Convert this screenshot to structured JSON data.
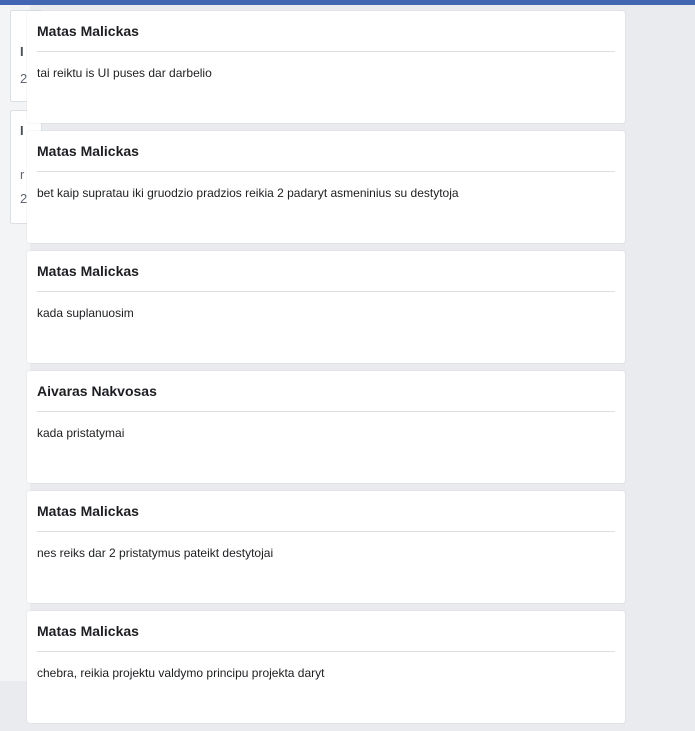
{
  "posts": [
    {
      "author": "Matas Malickas",
      "message": "tai reiktu is UI puses dar darbelio"
    },
    {
      "author": "Matas Malickas",
      "message": "bet kaip supratau iki gruodzio pradzios reikia 2 padaryt asmeninius su destytoja"
    },
    {
      "author": "Matas Malickas",
      "message": "kada suplanuosim"
    },
    {
      "author": "Aivaras Nakvosas",
      "message": "kada pristatymai"
    },
    {
      "author": "Matas Malickas",
      "message": "nes reiks dar 2 pristatymus pateikt destytojai"
    },
    {
      "author": "Matas Malickas",
      "message": "chebra, reikia projektu valdymo principu projekta daryt"
    }
  ],
  "underlay": {
    "glyphs": [
      "I",
      "2",
      "I",
      "r",
      "2"
    ]
  },
  "colors": {
    "background": "#e9ebee",
    "card": "#ffffff",
    "divider": "#dddfe2",
    "top_strip": "#4267b2"
  }
}
